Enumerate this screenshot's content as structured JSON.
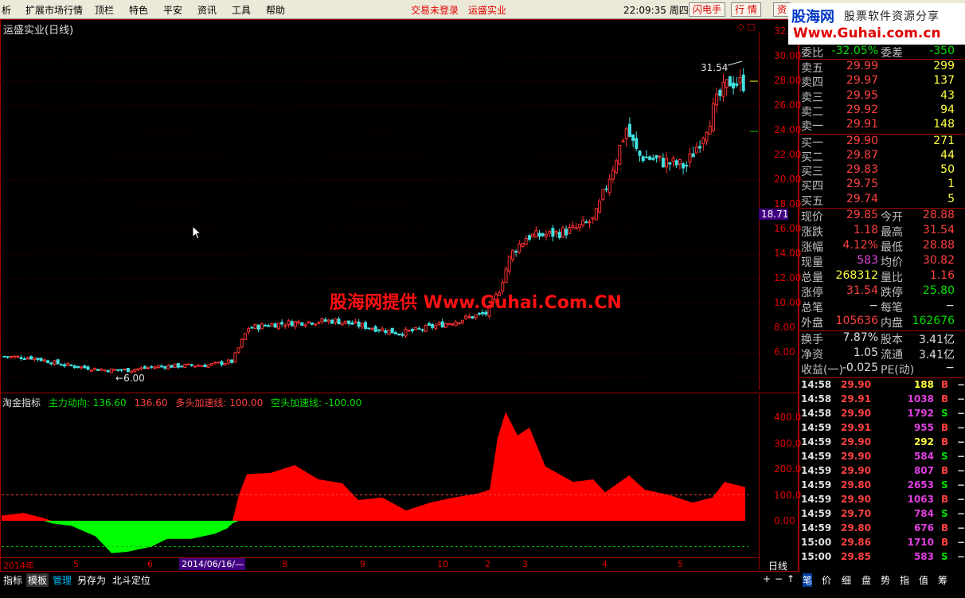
{
  "menubar": {
    "items": [
      "析",
      "扩展市场行情",
      "顶栏",
      "特色",
      "平安",
      "资讯",
      "工具",
      "帮助"
    ],
    "status_login": "交易未登录",
    "status_stock": "运盛实业",
    "clock": "22:09:35 周四",
    "btn_flash": "闪电手",
    "btn_quote": "行 情",
    "btn_more": "资"
  },
  "brand": {
    "line1": "股海网",
    "line2": "股票软件资源分享",
    "line3": "Www.Guhai.com.cn"
  },
  "chart": {
    "title": "运盛实业(日线)",
    "watermark": "股海网提供 Www.Guhai.Com.CN",
    "high_label": "31.54",
    "low_label": "6.00",
    "last_price_tag": "18.71",
    "price_ticks": [
      "32.00",
      "30.00",
      "28.00",
      "26.00",
      "24.00",
      "22.00",
      "20.00",
      "18.00",
      "16.00",
      "14.00",
      "12.00",
      "10.00",
      "8.00",
      "6.00"
    ],
    "ind_ticks": [
      "400.0",
      "300.0",
      "200.0",
      "100.0",
      "0.00"
    ],
    "date_ticks": [
      "2014年",
      "5",
      "6",
      "8",
      "9",
      "10",
      "2",
      "3",
      "4",
      "5"
    ],
    "date_highlight": "2014/06/16/—",
    "period": "日线",
    "colors": {
      "up": "#ff3030",
      "down": "#40e0e0",
      "ind_pos": "#ff0000",
      "ind_neg": "#00ff00"
    }
  },
  "indicator": {
    "name": "淘金指标",
    "main_label": "主力动向: 136.60",
    "main_value2": "136.60",
    "long_label": "多头加速线: 100.00",
    "short_label": "空头加速线: -100.00"
  },
  "bottombar": {
    "items": [
      "指标",
      "模板",
      "管理",
      "另存为",
      "北斗定位"
    ]
  },
  "rightbar": {
    "items": [
      "+",
      "−",
      "↑",
      "笔",
      "价",
      "细",
      "盘",
      "势",
      "指",
      "值",
      "筹"
    ]
  },
  "quote": {
    "weibi": {
      "label": "委比",
      "value": "-32.05%",
      "label2": "委差",
      "value2": "-350"
    },
    "asks": [
      {
        "label": "卖五",
        "price": "29.99",
        "vol": "299"
      },
      {
        "label": "卖四",
        "price": "29.97",
        "vol": "137"
      },
      {
        "label": "卖三",
        "price": "29.95",
        "vol": "43"
      },
      {
        "label": "卖二",
        "price": "29.92",
        "vol": "94"
      },
      {
        "label": "卖一",
        "price": "29.91",
        "vol": "148"
      }
    ],
    "bids": [
      {
        "label": "买一",
        "price": "29.90",
        "vol": "271"
      },
      {
        "label": "买二",
        "price": "29.87",
        "vol": "44"
      },
      {
        "label": "买三",
        "price": "29.83",
        "vol": "50"
      },
      {
        "label": "买四",
        "price": "29.75",
        "vol": "1"
      },
      {
        "label": "买五",
        "price": "29.74",
        "vol": "5"
      }
    ],
    "stats": [
      {
        "l1": "现价",
        "v1": "29.85",
        "c1": "red",
        "l2": "今开",
        "v2": "28.88",
        "c2": "red"
      },
      {
        "l1": "涨跌",
        "v1": "1.18",
        "c1": "red",
        "l2": "最高",
        "v2": "31.54",
        "c2": "red"
      },
      {
        "l1": "涨幅",
        "v1": "4.12%",
        "c1": "red",
        "l2": "最低",
        "v2": "28.88",
        "c2": "red"
      },
      {
        "l1": "现量",
        "v1": "583",
        "c1": "purple",
        "l2": "均价",
        "v2": "30.82",
        "c2": "red"
      },
      {
        "l1": "总量",
        "v1": "268312",
        "c1": "yellow",
        "l2": "量比",
        "v2": "1.16",
        "c2": "red"
      },
      {
        "l1": "涨停",
        "v1": "31.54",
        "c1": "red",
        "l2": "跌停",
        "v2": "25.80",
        "c2": "green"
      },
      {
        "l1": "总笔",
        "v1": "−",
        "c1": "white",
        "l2": "每笔",
        "v2": "−",
        "c2": "white"
      },
      {
        "l1": "外盘",
        "v1": "105636",
        "c1": "red",
        "l2": "内盘",
        "v2": "162676",
        "c2": "green"
      }
    ],
    "fund": [
      {
        "l1": "换手",
        "v1": "7.87%",
        "l2": "股本",
        "v2": "3.41亿"
      },
      {
        "l1": "净资",
        "v1": "1.05",
        "l2": "流通",
        "v2": "3.41亿"
      },
      {
        "l1": "收益(一)",
        "v1": "-0.025",
        "l2": "PE(动)",
        "v2": "−"
      }
    ],
    "ticks": [
      {
        "t": "14:58",
        "p": "29.90",
        "v": "188",
        "vc": "yellow",
        "s": "B",
        "sc": "red"
      },
      {
        "t": "14:58",
        "p": "29.91",
        "v": "1038",
        "vc": "purple",
        "s": "B",
        "sc": "red"
      },
      {
        "t": "14:58",
        "p": "29.90",
        "v": "1792",
        "vc": "purple",
        "s": "S",
        "sc": "green"
      },
      {
        "t": "14:59",
        "p": "29.91",
        "v": "955",
        "vc": "purple",
        "s": "B",
        "sc": "red"
      },
      {
        "t": "14:59",
        "p": "29.90",
        "v": "292",
        "vc": "yellow",
        "s": "B",
        "sc": "red"
      },
      {
        "t": "14:59",
        "p": "29.90",
        "v": "584",
        "vc": "purple",
        "s": "S",
        "sc": "green"
      },
      {
        "t": "14:59",
        "p": "29.90",
        "v": "807",
        "vc": "purple",
        "s": "B",
        "sc": "red"
      },
      {
        "t": "14:59",
        "p": "29.80",
        "v": "2653",
        "vc": "purple",
        "s": "S",
        "sc": "green"
      },
      {
        "t": "14:59",
        "p": "29.90",
        "v": "1063",
        "vc": "purple",
        "s": "B",
        "sc": "red"
      },
      {
        "t": "14:59",
        "p": "29.70",
        "v": "784",
        "vc": "purple",
        "s": "S",
        "sc": "green"
      },
      {
        "t": "14:59",
        "p": "29.80",
        "v": "676",
        "vc": "purple",
        "s": "B",
        "sc": "red"
      },
      {
        "t": "15:00",
        "p": "29.86",
        "v": "1710",
        "vc": "purple",
        "s": "B",
        "sc": "red"
      },
      {
        "t": "15:00",
        "p": "29.85",
        "v": "583",
        "vc": "purple",
        "s": "S",
        "sc": "green"
      }
    ],
    "dash": "−"
  }
}
